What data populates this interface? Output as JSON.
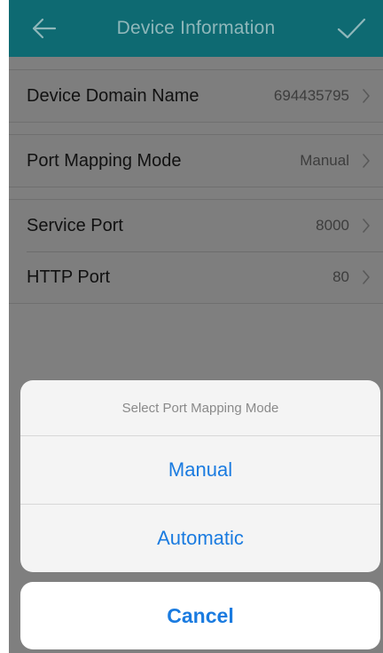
{
  "nav": {
    "title": "Device Information",
    "back_icon": "back-arrow-icon",
    "confirm_icon": "checkmark-icon"
  },
  "groups": [
    {
      "rows": [
        {
          "label": "Device Domain Name",
          "value": "694435795"
        }
      ]
    },
    {
      "rows": [
        {
          "label": "Port Mapping Mode",
          "value": "Manual"
        }
      ]
    },
    {
      "rows": [
        {
          "label": "Service Port",
          "value": "8000"
        },
        {
          "label": "HTTP Port",
          "value": "80"
        }
      ]
    }
  ],
  "action_sheet": {
    "title": "Select Port Mapping Mode",
    "options": [
      "Manual",
      "Automatic"
    ],
    "cancel_label": "Cancel"
  },
  "colors": {
    "nav_bar": "#0e6a72",
    "overlay": "#7f7f7f",
    "action_blue": "#1a7be0"
  }
}
